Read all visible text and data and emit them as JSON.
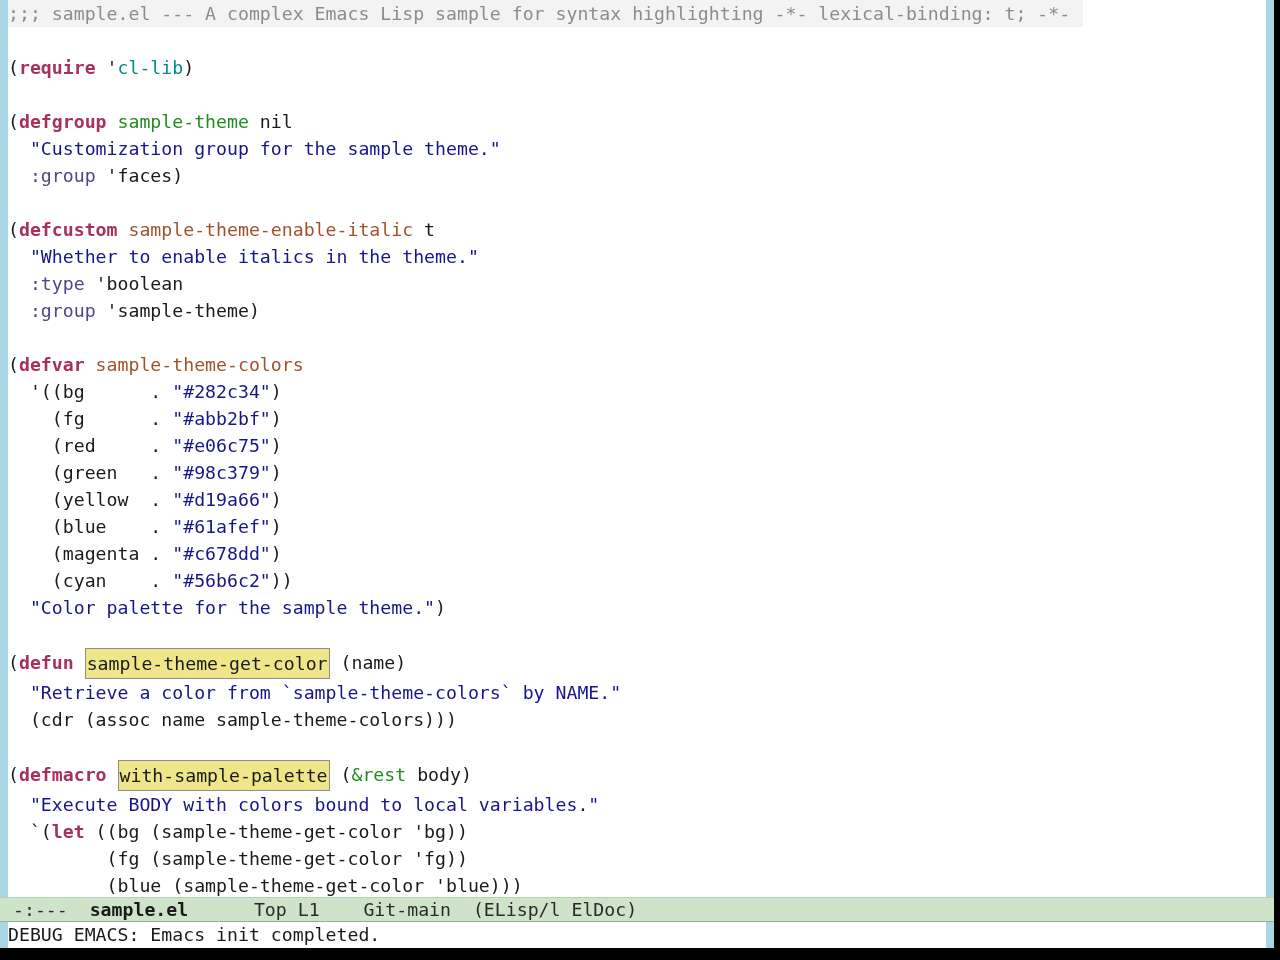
{
  "buffer": {
    "lines": [
      {
        "kind": "code",
        "tokens": [
          {
            "kind": "comment",
            "text": ";;; sample.el --- A complex Emacs Lisp sample for syntax highlighting -*- lexical-binding: t; -*-"
          }
        ]
      },
      {
        "kind": "blank"
      },
      {
        "kind": "code",
        "tokens": [
          {
            "kind": "plain",
            "text": "("
          },
          {
            "kind": "keyword",
            "text": "require"
          },
          {
            "kind": "plain",
            "text": " '"
          },
          {
            "kind": "constant",
            "text": "cl-lib"
          },
          {
            "kind": "plain",
            "text": ")"
          }
        ]
      },
      {
        "kind": "blank"
      },
      {
        "kind": "code",
        "tokens": [
          {
            "kind": "plain",
            "text": "("
          },
          {
            "kind": "keyword",
            "text": "defgroup "
          },
          {
            "kind": "type",
            "text": "sample-theme"
          },
          {
            "kind": "plain",
            "text": " nil"
          }
        ]
      },
      {
        "kind": "code",
        "tokens": [
          {
            "kind": "string",
            "text": "  \"Customization group for the sample theme.\""
          }
        ]
      },
      {
        "kind": "code",
        "tokens": [
          {
            "kind": "builtin",
            "text": "  :group"
          },
          {
            "kind": "plain",
            "text": " 'faces)"
          }
        ]
      },
      {
        "kind": "blank"
      },
      {
        "kind": "code",
        "tokens": [
          {
            "kind": "plain",
            "text": "("
          },
          {
            "kind": "keyword",
            "text": "defcustom "
          },
          {
            "kind": "variable",
            "text": "sample-theme-enable-italic"
          },
          {
            "kind": "plain",
            "text": " t"
          }
        ]
      },
      {
        "kind": "code",
        "tokens": [
          {
            "kind": "string",
            "text": "  \"Whether to enable italics in the theme.\""
          }
        ]
      },
      {
        "kind": "code",
        "tokens": [
          {
            "kind": "builtin",
            "text": "  :type"
          },
          {
            "kind": "plain",
            "text": " 'boolean"
          }
        ]
      },
      {
        "kind": "code",
        "tokens": [
          {
            "kind": "builtin",
            "text": "  :group"
          },
          {
            "kind": "plain",
            "text": " 'sample-theme)"
          }
        ]
      },
      {
        "kind": "blank"
      },
      {
        "kind": "code",
        "tokens": [
          {
            "kind": "plain",
            "text": "("
          },
          {
            "kind": "keyword",
            "text": "defvar "
          },
          {
            "kind": "variable",
            "text": "sample-theme-colors"
          }
        ]
      },
      {
        "kind": "code",
        "tokens": [
          {
            "kind": "plain",
            "text": "  '((bg      . "
          },
          {
            "kind": "string",
            "text": "\"#282c34\""
          },
          {
            "kind": "plain",
            "text": ")"
          }
        ]
      },
      {
        "kind": "code",
        "tokens": [
          {
            "kind": "plain",
            "text": "    (fg      . "
          },
          {
            "kind": "string",
            "text": "\"#abb2bf\""
          },
          {
            "kind": "plain",
            "text": ")"
          }
        ]
      },
      {
        "kind": "code",
        "tokens": [
          {
            "kind": "plain",
            "text": "    (red     . "
          },
          {
            "kind": "string",
            "text": "\"#e06c75\""
          },
          {
            "kind": "plain",
            "text": ")"
          }
        ]
      },
      {
        "kind": "code",
        "tokens": [
          {
            "kind": "plain",
            "text": "    (green   . "
          },
          {
            "kind": "string",
            "text": "\"#98c379\""
          },
          {
            "kind": "plain",
            "text": ")"
          }
        ]
      },
      {
        "kind": "code",
        "tokens": [
          {
            "kind": "plain",
            "text": "    (yellow  . "
          },
          {
            "kind": "string",
            "text": "\"#d19a66\""
          },
          {
            "kind": "plain",
            "text": ")"
          }
        ]
      },
      {
        "kind": "code",
        "tokens": [
          {
            "kind": "plain",
            "text": "    (blue    . "
          },
          {
            "kind": "string",
            "text": "\"#61afef\""
          },
          {
            "kind": "plain",
            "text": ")"
          }
        ]
      },
      {
        "kind": "code",
        "tokens": [
          {
            "kind": "plain",
            "text": "    (magenta . "
          },
          {
            "kind": "string",
            "text": "\"#c678dd\""
          },
          {
            "kind": "plain",
            "text": ")"
          }
        ]
      },
      {
        "kind": "code",
        "tokens": [
          {
            "kind": "plain",
            "text": "    (cyan    . "
          },
          {
            "kind": "string",
            "text": "\"#56b6c2\""
          },
          {
            "kind": "plain",
            "text": "))"
          }
        ]
      },
      {
        "kind": "code",
        "tokens": [
          {
            "kind": "string",
            "text": "  \"Color palette for the sample theme.\""
          },
          {
            "kind": "plain",
            "text": ")"
          }
        ]
      },
      {
        "kind": "blank"
      },
      {
        "kind": "code",
        "tokens": [
          {
            "kind": "plain",
            "text": "("
          },
          {
            "kind": "keyword",
            "text": "defun "
          },
          {
            "kind": "highlight",
            "text": "sample-theme-get-color"
          },
          {
            "kind": "plain",
            "text": " (name)"
          }
        ]
      },
      {
        "kind": "code",
        "tokens": [
          {
            "kind": "string",
            "text": "  \"Retrieve a color from `sample-theme-colors` by NAME.\""
          }
        ]
      },
      {
        "kind": "code",
        "tokens": [
          {
            "kind": "plain",
            "text": "  (cdr (assoc name sample-theme-colors)))"
          }
        ]
      },
      {
        "kind": "blank"
      },
      {
        "kind": "code",
        "tokens": [
          {
            "kind": "plain",
            "text": "("
          },
          {
            "kind": "keyword",
            "text": "defmacro "
          },
          {
            "kind": "highlight",
            "text": "with-sample-palette"
          },
          {
            "kind": "plain",
            "text": " ("
          },
          {
            "kind": "type",
            "text": "&rest"
          },
          {
            "kind": "plain",
            "text": " body)"
          }
        ]
      },
      {
        "kind": "code",
        "tokens": [
          {
            "kind": "string",
            "text": "  \"Execute BODY with colors bound to local variables.\""
          }
        ]
      },
      {
        "kind": "code",
        "tokens": [
          {
            "kind": "plain",
            "text": "  `("
          },
          {
            "kind": "keyword",
            "text": "let"
          },
          {
            "kind": "plain",
            "text": " ((bg (sample-theme-get-color 'bg))"
          }
        ]
      },
      {
        "kind": "code",
        "tokens": [
          {
            "kind": "plain",
            "text": "         (fg (sample-theme-get-color 'fg))"
          }
        ]
      },
      {
        "kind": "code",
        "tokens": [
          {
            "kind": "plain",
            "text": "         (blue (sample-theme-get-color 'blue)))"
          }
        ]
      }
    ]
  },
  "mode_line": {
    "status": "-:---",
    "buffer_name": "sample.el",
    "position": "Top L1",
    "vc_branch": "Git-main",
    "modes": "(ELisp/l ElDoc)"
  },
  "echo_area": {
    "message": "DEBUG EMACS: Emacs init completed."
  }
}
